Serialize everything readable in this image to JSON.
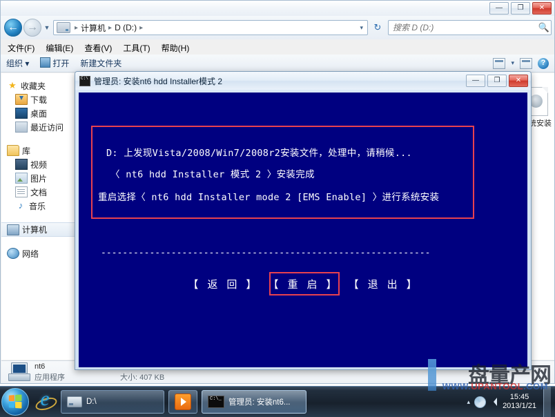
{
  "explorer": {
    "window_controls": {
      "minimize": "—",
      "restore": "❐",
      "close": "✕"
    },
    "address": {
      "crumbs": [
        "计算机",
        "D (D:)"
      ],
      "separator": "▸",
      "dropdown_caret": "▾",
      "refresh": "↻"
    },
    "search": {
      "placeholder": "搜索 D (D:)",
      "icon": "search-icon"
    },
    "menu": [
      {
        "label": "文件(F)"
      },
      {
        "label": "编辑(E)"
      },
      {
        "label": "查看(V)"
      },
      {
        "label": "工具(T)"
      },
      {
        "label": "帮助(H)"
      }
    ],
    "toolbar": {
      "organize": "组织 ▾",
      "open": "打开",
      "new_folder": "新建文件夹",
      "view_caret": "▾",
      "help": "?"
    },
    "sidebar": {
      "groups": [
        {
          "header": "收藏夹",
          "header_icon": "star-icon",
          "items": [
            {
              "label": "下载",
              "icon": "download-icon"
            },
            {
              "label": "桌面",
              "icon": "desktop-icon"
            },
            {
              "label": "最近访问",
              "icon": "recent-places-icon"
            }
          ]
        },
        {
          "header": "库",
          "header_icon": "library-icon",
          "items": [
            {
              "label": "视频",
              "icon": "video-icon"
            },
            {
              "label": "图片",
              "icon": "pictures-icon"
            },
            {
              "label": "文档",
              "icon": "documents-icon"
            },
            {
              "label": "音乐",
              "icon": "music-icon"
            }
          ]
        }
      ],
      "computer": {
        "label": "计算机",
        "icon": "computer-icon"
      },
      "network": {
        "label": "网络",
        "icon": "network-icon"
      }
    },
    "content": {
      "files": [
        {
          "name": "系统安装",
          "icon": "disc-file-icon"
        }
      ]
    },
    "details": {
      "name": "nt6",
      "type": "应用程序",
      "size_label": "大小: 407 KB"
    }
  },
  "console": {
    "title": "管理员:  安装nt6 hdd Installer模式 2",
    "icon": "cmd-icon",
    "window_controls": {
      "minimize": "—",
      "restore": "❐",
      "close": "✕"
    },
    "background_color": "#000080",
    "highlight_color": "#e8414f",
    "message_lines": [
      "D: 上发现Vista/2008/Win7/2008r2安装文件，处理中，请稍候...",
      "〈 nt6 hdd Installer 模式 2 〉安装完成",
      "重启选择〈 nt6 hdd Installer mode 2 [EMS Enable] 〉进行系统安装"
    ],
    "divider": "-------------------------------------------------------------",
    "buttons": [
      {
        "label": "【 返 回 】",
        "highlighted": false
      },
      {
        "label": "【 重 启 】",
        "highlighted": true
      },
      {
        "label": "【 退 出 】",
        "highlighted": false
      }
    ]
  },
  "taskbar": {
    "start": {
      "name": "start-orb"
    },
    "quick_launch": [
      {
        "label": "",
        "icon": "internet-explorer-icon"
      }
    ],
    "buttons": [
      {
        "label": "D:\\",
        "icon": "drive-icon",
        "active": false
      },
      {
        "label": "",
        "icon": "media-player-icon",
        "active": false
      },
      {
        "label": "管理员:  安装nt6...",
        "icon": "cmd-icon",
        "active": true
      }
    ],
    "tray": {
      "arrow": "▴",
      "icons": [
        "network-icon",
        "volume-icon"
      ],
      "time": "15:45",
      "date": "2013/1/21"
    }
  },
  "watermark": {
    "main": "盘量产网",
    "sub_prefix": "WWW.",
    "sub_mid": "UPANTOOL",
    "sub_suffix": ".COM"
  }
}
